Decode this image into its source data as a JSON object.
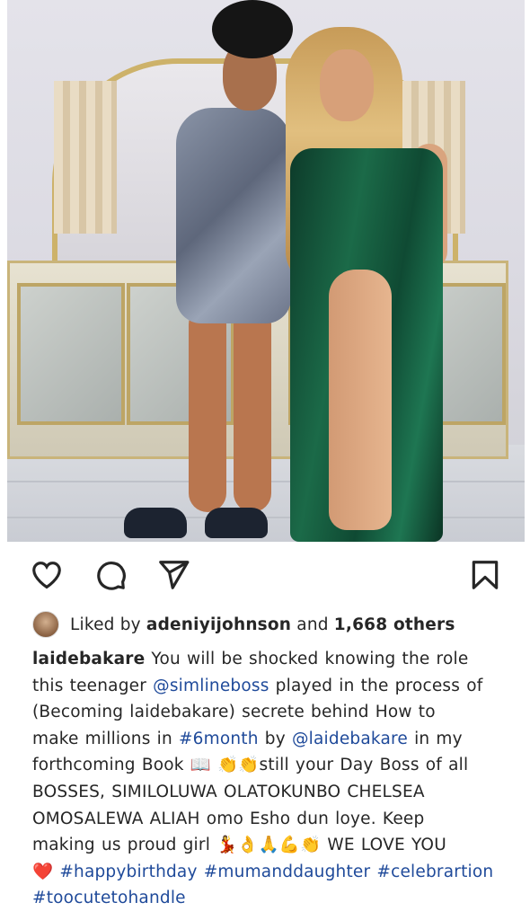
{
  "post": {
    "photo_alt": "",
    "likes": {
      "prefix": "Liked by",
      "user": "adeniyijohnson",
      "middle": "and",
      "count": "1,668 others"
    },
    "caption": {
      "author": "laidebakare",
      "line1": " You will be shocked knowing the role",
      "line2_a": "this teenager ",
      "mention1": "@simlineboss",
      "line2_b": " played in the process of",
      "line3": "(Becoming laidebakare)  secrete behind How to",
      "line4_a": "make millions in ",
      "hashtag1": "#6month",
      "line4_b": " by ",
      "mention2": "@laidebakare",
      "line4_c": " in my",
      "line5": "forthcoming Book 📖 👏👏still your Day Boss of all",
      "line6": "BOSSES, SIMILOLUWA OLATOKUNBO CHELSEA",
      "line7": "OMOSALEWA ALIAH omo Esho dun loye. Keep",
      "line8": "making us proud girl 💃👌🙏💪👏 WE LOVE YOU",
      "line9_a": "❤️ ",
      "hashtag2": "#happybirthday",
      "hashtag3": "#mumanddaughter",
      "hashtag4": "#celebrartion",
      "hashtag5": "#toocutetohandle"
    }
  },
  "icons": {
    "like": "heart-icon",
    "comment": "comment-icon",
    "share": "send-icon",
    "save": "bookmark-icon"
  }
}
